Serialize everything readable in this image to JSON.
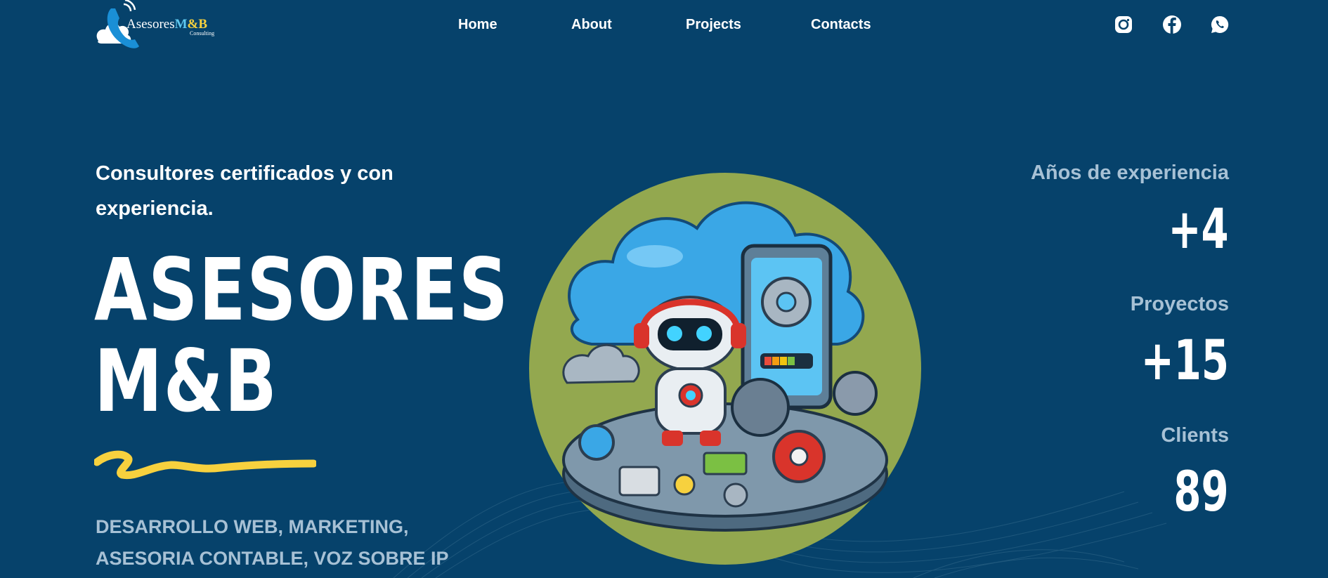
{
  "colors": {
    "background": "#06426b",
    "accent_yellow": "#f7d13e",
    "circle_green": "#93a84f",
    "muted_text": "#a7c1d5"
  },
  "logo": {
    "name_main": "Asesores",
    "name_brand": "M",
    "name_amp": "&",
    "name_end": "B",
    "subtitle": "Consulting"
  },
  "nav": {
    "items": [
      {
        "label": "Home"
      },
      {
        "label": "About"
      },
      {
        "label": "Projects"
      },
      {
        "label": "Contacts"
      }
    ]
  },
  "socials": [
    {
      "icon": "instagram-icon"
    },
    {
      "icon": "facebook-icon"
    },
    {
      "icon": "whatsapp-icon"
    }
  ],
  "hero": {
    "tagline": "Consultores certificados y con experiencia.",
    "title_line1": "ASESORES",
    "title_line2": "M&B",
    "services": "DESARROLLO WEB, MARKETING, ASESORIA CONTABLE, VOZ SOBRE IP"
  },
  "stats": [
    {
      "label": "Años de experiencia",
      "value": "+4"
    },
    {
      "label": "Proyectos",
      "value": "+15"
    },
    {
      "label": "Clients",
      "value": "89"
    }
  ]
}
